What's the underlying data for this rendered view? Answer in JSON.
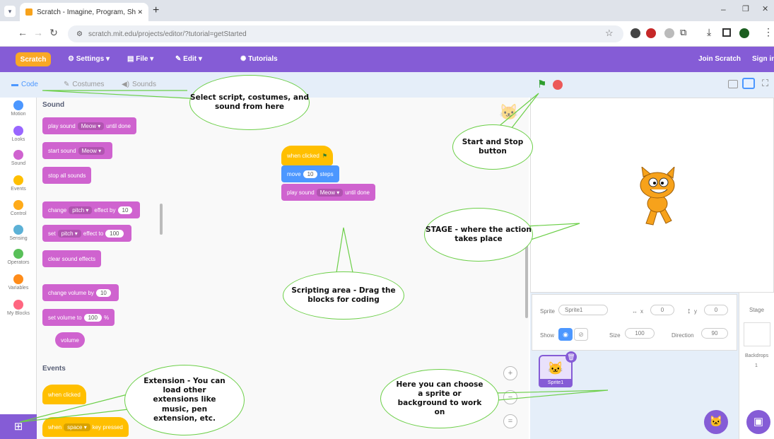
{
  "browser": {
    "tab_title": "Scratch - Imagine, Program, Sh",
    "new_tab": "+",
    "url": "scratch.mit.edu/projects/editor/?tutorial=getStarted",
    "window_controls": [
      "–",
      "❐",
      "✕"
    ]
  },
  "menubar": {
    "logo": "Scratch",
    "settings": "Settings",
    "file": "File",
    "edit": "Edit",
    "tutorials": "Tutorials",
    "join": "Join Scratch",
    "signin": "Sign in"
  },
  "editor_tabs": {
    "code": "Code",
    "costumes": "Costumes",
    "sounds": "Sounds"
  },
  "categories": [
    {
      "label": "Motion",
      "color": "#4c97ff"
    },
    {
      "label": "Looks",
      "color": "#9966ff"
    },
    {
      "label": "Sound",
      "color": "#cf63cf"
    },
    {
      "label": "Events",
      "color": "#ffbf00"
    },
    {
      "label": "Control",
      "color": "#ffab19"
    },
    {
      "label": "Sensing",
      "color": "#5cb1d6"
    },
    {
      "label": "Operators",
      "color": "#59c059"
    },
    {
      "label": "Variables",
      "color": "#ff8c1a"
    },
    {
      "label": "My Blocks",
      "color": "#ff6680"
    }
  ],
  "palette": {
    "sound_heading": "Sound",
    "play_sound": "play sound",
    "play_sound_tail": "until done",
    "start_sound": "start sound",
    "meow": "Meow",
    "stop_all": "stop all sounds",
    "change": "change",
    "pitch": "pitch",
    "effect_by": "effect by",
    "val_10": "10",
    "set": "set",
    "effect_to": "effect to",
    "val_100": "100",
    "clear_effects": "clear sound effects",
    "change_volume": "change volume by",
    "set_volume": "set volume to",
    "percent": "%",
    "volume": "volume",
    "events_heading": "Events",
    "when_flag": "when clicked",
    "when_key": "when",
    "space": "space",
    "key_pressed": "key pressed"
  },
  "script": {
    "hat": "when clicked",
    "move": "move",
    "steps_val": "10",
    "steps": "steps",
    "play": "play sound",
    "meow": "Meow",
    "until": "until done"
  },
  "sprite_info": {
    "sprite_label": "Sprite",
    "sprite_name": "Sprite1",
    "x_label": "x",
    "x_val": "0",
    "y_label": "y",
    "y_val": "0",
    "show_label": "Show",
    "size_label": "Size",
    "size_val": "100",
    "direction_label": "Direction",
    "direction_val": "90",
    "thumb_label": "Sprite1"
  },
  "stage_panel": {
    "title": "Stage",
    "backdrops_label": "Backdrops",
    "backdrops_count": "1"
  },
  "callouts": {
    "select": "Select script, costumes, and sound from here",
    "startstop": "Start and Stop button",
    "stage": "STAGE - where the action takes place",
    "scripting": "Scripting area - Drag the blocks for coding",
    "extension": "Extension - You can load other extensions like music, pen extension, etc.",
    "sprite": "Here you can choose a sprite or background to work on"
  }
}
